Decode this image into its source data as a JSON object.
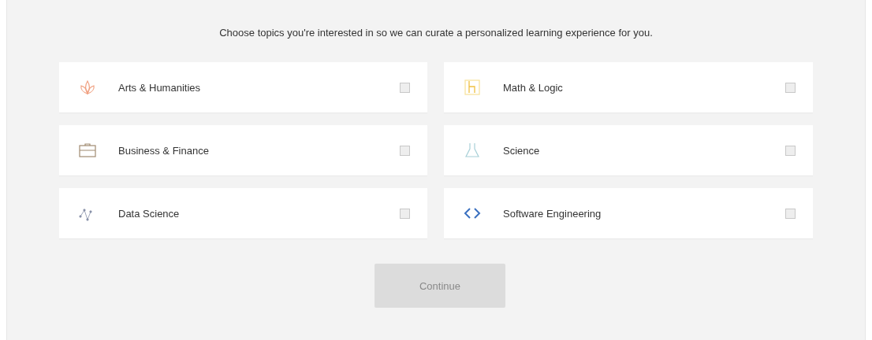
{
  "intro": "Choose topics you're interested in so we can curate a personalized learning experience for you.",
  "topics": [
    {
      "label": "Arts & Humanities",
      "kind": "arts",
      "checked": false
    },
    {
      "label": "Math & Logic",
      "kind": "math",
      "checked": false
    },
    {
      "label": "Business & Finance",
      "kind": "business",
      "checked": false
    },
    {
      "label": "Science",
      "kind": "science",
      "checked": false
    },
    {
      "label": "Data Science",
      "kind": "data",
      "checked": false
    },
    {
      "label": "Software Engineering",
      "kind": "code",
      "checked": false
    }
  ],
  "continue_button": {
    "label": "Continue",
    "disabled": true
  }
}
